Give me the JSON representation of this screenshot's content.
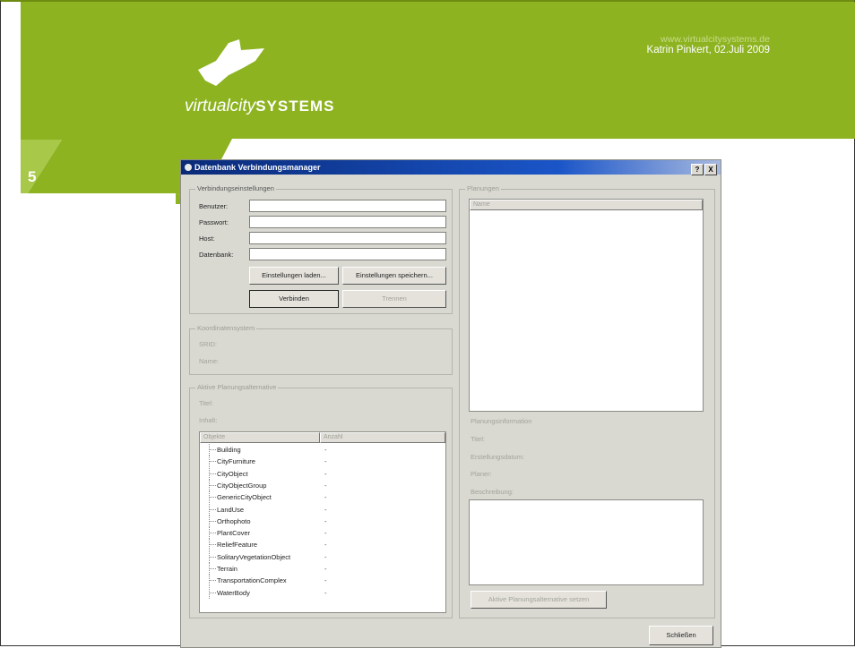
{
  "header": {
    "url": "www.virtualcitysystems.de",
    "author_date": "Katrin Pinkert, 02.Juli 2009",
    "logo_italic": "virtualcity",
    "logo_caps": "SYSTEMS",
    "slide_number": "5"
  },
  "colors": {
    "brand_green": "#8db321",
    "light_green": "#a8c84a",
    "titlebar_blue": "#1a55c8",
    "dialog_gray": "#d9d9d2"
  },
  "dialog": {
    "title": "Datenbank Verbindungsmanager",
    "title_buttons": {
      "help": "?",
      "close": "X"
    },
    "connection_settings": {
      "title": "Verbindungseinstellungen",
      "user_label": "Benutzer:",
      "user_value": "",
      "password_label": "Passwort:",
      "password_value": "",
      "host_label": "Host:",
      "host_value": "",
      "database_label": "Datenbank:",
      "database_value": "",
      "load_button": "Einstellungen laden...",
      "save_button": "Einstellungen speichern...",
      "connect_button": "Verbinden",
      "disconnect_button": "Trennen"
    },
    "coordinate_system": {
      "title": "Koordinatensystem",
      "srid_label": "SRID:",
      "name_label": "Name:"
    },
    "active_planning": {
      "title": "Aktive Planungsalternative",
      "title_label": "Titel:",
      "content_label": "Inhalt:",
      "columns": [
        "Objekte",
        "Anzahl"
      ],
      "rows": [
        {
          "name": "Building",
          "count": "-"
        },
        {
          "name": "CityFurniture",
          "count": "-"
        },
        {
          "name": "CityObject",
          "count": "-"
        },
        {
          "name": "CityObjectGroup",
          "count": "-"
        },
        {
          "name": "GenericCityObject",
          "count": "-"
        },
        {
          "name": "LandUse",
          "count": "-"
        },
        {
          "name": "Orthophoto",
          "count": "-"
        },
        {
          "name": "PlantCover",
          "count": "-"
        },
        {
          "name": "ReliefFeature",
          "count": "-"
        },
        {
          "name": "SolitaryVegetationObject",
          "count": "-"
        },
        {
          "name": "Terrain",
          "count": "-"
        },
        {
          "name": "TransportationComplex",
          "count": "-"
        },
        {
          "name": "WaterBody",
          "count": "-"
        }
      ]
    },
    "plannings": {
      "title": "Planungen",
      "column_name": "Name",
      "info_title": "Planungsinformation",
      "title_label": "Titel:",
      "created_label": "Erstellungsdatum:",
      "planner_label": "Planer:",
      "description_label": "Beschreibung:",
      "set_active_button": "Aktive Planungsalternative setzen"
    },
    "close_button": "Schließen"
  }
}
